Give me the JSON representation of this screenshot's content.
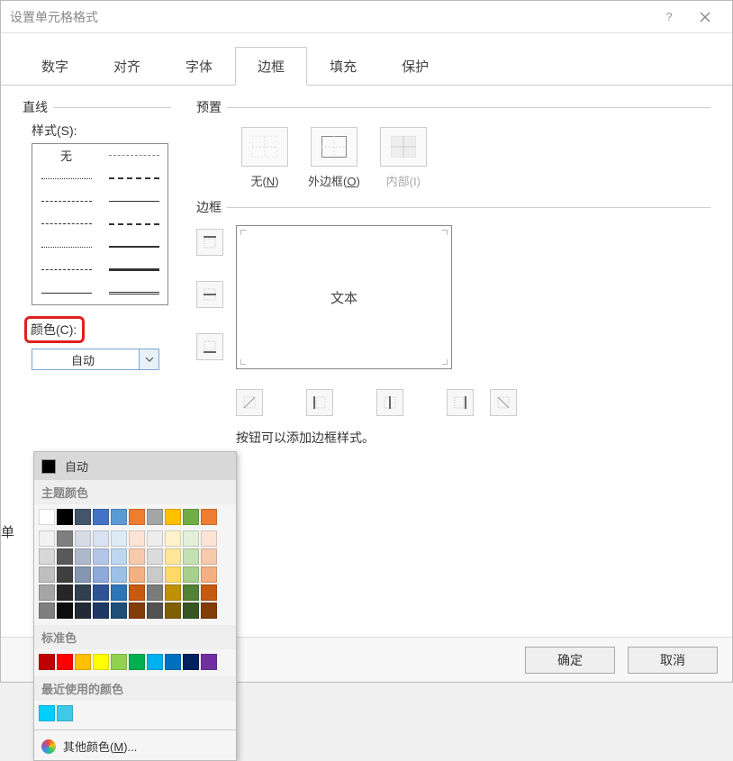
{
  "title": "设置单元格格式",
  "tabs": [
    "数字",
    "对齐",
    "字体",
    "边框",
    "填充",
    "保护"
  ],
  "activeTab": 3,
  "line": {
    "section": "直线",
    "styleLabel": "样式(S):",
    "none": "无"
  },
  "color": {
    "label": "颜色(C):",
    "auto": "自动"
  },
  "preset": {
    "section": "预置",
    "none": "无(N)",
    "outer": "外边框(O)",
    "inner": "内部(I)"
  },
  "border": {
    "section": "边框",
    "previewText": "文本"
  },
  "hint": "按钮可以添加边框样式。",
  "behindChar": "单",
  "popup": {
    "auto": "自动",
    "themeLabel": "主题颜色",
    "standardLabel": "标准色",
    "recentLabel": "最近使用的颜色",
    "more": "其他颜色(M)...",
    "themeRow0": [
      "#ffffff",
      "#000000",
      "#44546a",
      "#4472c4",
      "#5b9bd5",
      "#ed7d31",
      "#a5a5a5",
      "#ffc000",
      "#70ad47",
      "#ed7d31"
    ],
    "themeShades": [
      [
        "#f2f2f2",
        "#7f7f7f",
        "#d6dce4",
        "#d9e2f3",
        "#deebf6",
        "#fbe4d5",
        "#ededed",
        "#fff2cc",
        "#e2efd9",
        "#fbe4d5"
      ],
      [
        "#d8d8d8",
        "#595959",
        "#adb9ca",
        "#b4c6e7",
        "#bdd7ee",
        "#f7caac",
        "#dbdbdb",
        "#fee599",
        "#c5e0b3",
        "#f7caac"
      ],
      [
        "#bfbfbf",
        "#3f3f3f",
        "#8496b0",
        "#8eaadb",
        "#9bc2e6",
        "#f4b083",
        "#c9c9c9",
        "#ffd965",
        "#a8d08d",
        "#f4b083"
      ],
      [
        "#a5a5a5",
        "#262626",
        "#323f4f",
        "#2f5496",
        "#2e75b5",
        "#c55a11",
        "#7b7b7b",
        "#bf9000",
        "#538135",
        "#c55a11"
      ],
      [
        "#7f7f7f",
        "#0c0c0c",
        "#222a35",
        "#1f3864",
        "#1e4e79",
        "#833c0b",
        "#525252",
        "#7f6000",
        "#375623",
        "#833c0b"
      ]
    ],
    "standard": [
      "#c00000",
      "#ff0000",
      "#ffc000",
      "#ffff00",
      "#92d050",
      "#00b050",
      "#00b0f0",
      "#0070c0",
      "#002060",
      "#7030a0"
    ],
    "recent": [
      "#00d0ff",
      "#40c8e8"
    ]
  },
  "buttons": {
    "ok": "确定",
    "cancel": "取消"
  }
}
